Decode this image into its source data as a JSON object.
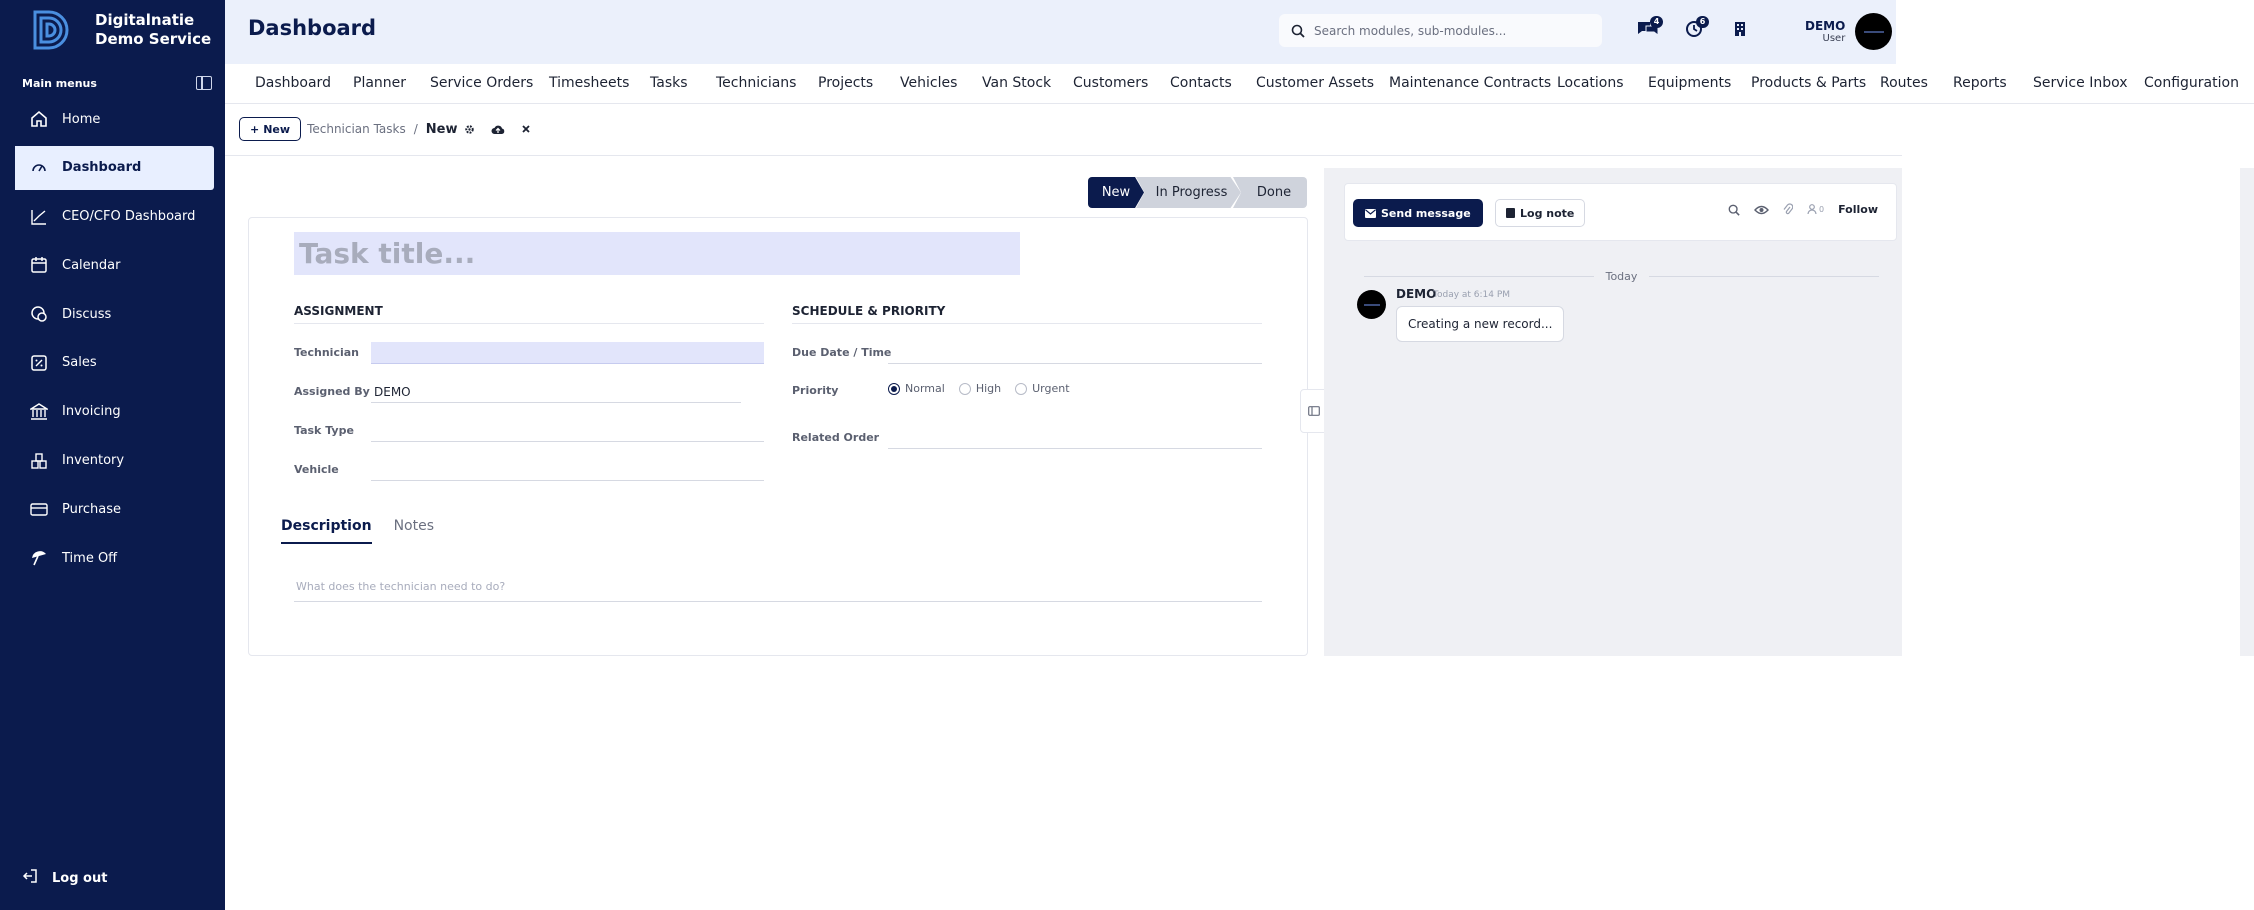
{
  "brand": {
    "line1": "Digitalnatie",
    "line2": "Demo Service"
  },
  "sidebar": {
    "heading": "Main menus",
    "items": [
      {
        "label": "Home",
        "icon": "home-icon"
      },
      {
        "label": "Dashboard",
        "icon": "dashboard-icon",
        "active": true
      },
      {
        "label": "CEO/CFO Dashboard",
        "icon": "chart-line-icon"
      },
      {
        "label": "Calendar",
        "icon": "calendar-icon"
      },
      {
        "label": "Discuss",
        "icon": "discuss-icon"
      },
      {
        "label": "Sales",
        "icon": "sales-icon"
      },
      {
        "label": "Invoicing",
        "icon": "bank-icon"
      },
      {
        "label": "Inventory",
        "icon": "inventory-icon"
      },
      {
        "label": "Purchase",
        "icon": "card-icon"
      },
      {
        "label": "Time Off",
        "icon": "umbrella-icon"
      }
    ],
    "logout_label": "Log out"
  },
  "header": {
    "title": "Dashboard",
    "search_placeholder": "Search modules, sub-modules...",
    "messages_count": "4",
    "activities_count": "6",
    "user_name": "DEMO",
    "user_role": "User"
  },
  "modules": [
    "Dashboard",
    "Planner",
    "Service Orders",
    "Timesheets",
    "Tasks",
    "Technicians",
    "Projects",
    "Vehicles",
    "Van Stock",
    "Customers",
    "Contacts",
    "Customer Assets",
    "Maintenance Contracts",
    "Locations",
    "Equipments",
    "Products & Parts",
    "Routes",
    "Reports",
    "Service Inbox",
    "Configuration"
  ],
  "breadcrumb": {
    "new_button": "New",
    "parent": "Technician Tasks",
    "separator": "/",
    "current": "New"
  },
  "status_stages": [
    "New",
    "In Progress",
    "Done"
  ],
  "form": {
    "title_placeholder": "Task title...",
    "assignment_title": "ASSIGNMENT",
    "schedule_title": "SCHEDULE & PRIORITY",
    "technician_label": "Technician",
    "technician_value": "",
    "assigned_by_label": "Assigned By",
    "assigned_by_value": "DEMO",
    "task_type_label": "Task Type",
    "task_type_value": "",
    "vehicle_label": "Vehicle",
    "vehicle_value": "",
    "due_label": "Due Date / Time",
    "due_value": "",
    "priority_label": "Priority",
    "priority_options": [
      "Normal",
      "High",
      "Urgent"
    ],
    "priority_selected": "Normal",
    "related_label": "Related Order",
    "related_value": "",
    "tabs": [
      "Description",
      "Notes"
    ],
    "description_placeholder": "What does the technician need to do?"
  },
  "chatter": {
    "send_message": "Send message",
    "log_note": "Log note",
    "followers_count": "0",
    "follow": "Follow",
    "today": "Today",
    "message": {
      "author": "DEMO",
      "time": "Today at 6:14 PM",
      "body": "Creating a new record..."
    }
  },
  "colors": {
    "primary": "#0b1b4d",
    "topbar": "#ebf0fb",
    "highlight": "#e2e5fb"
  }
}
